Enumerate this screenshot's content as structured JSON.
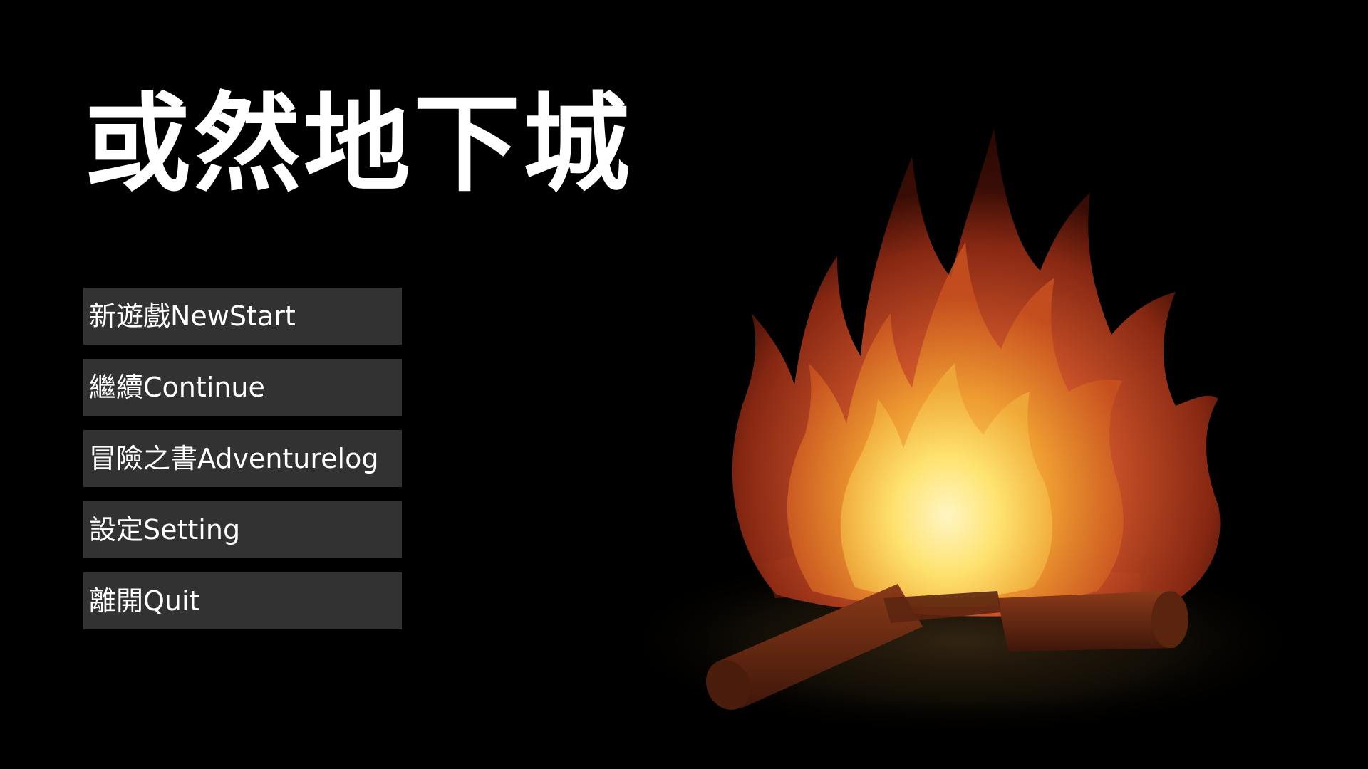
{
  "title": "或然地下城",
  "menu": {
    "new_game": "新遊戲NewStart",
    "continue": "繼續Continue",
    "adventure_log": "冒險之書Adventurelog",
    "settings": "設定Setting",
    "quit": "離開Quit"
  },
  "colors": {
    "background": "#000000",
    "title": "#ffffff",
    "button_bg": "#323232",
    "button_text": "#ffffff",
    "flame_outer": "#c0401a",
    "flame_mid": "#e8821e",
    "flame_core": "#ffe36a",
    "log": "#6b2c12"
  },
  "decoration": "campfire"
}
